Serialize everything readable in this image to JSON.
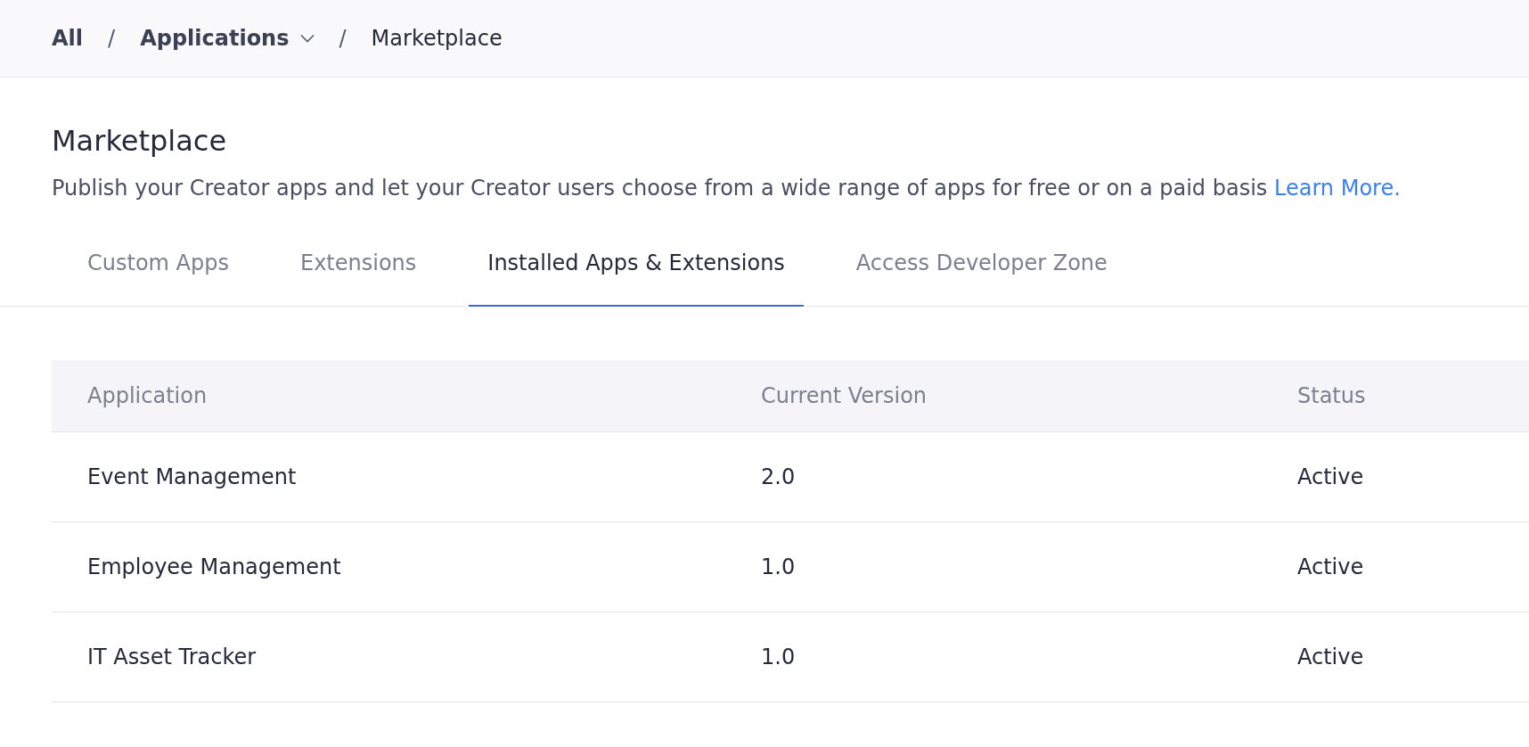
{
  "breadcrumb": [
    {
      "label": "All",
      "dropdown": false
    },
    {
      "label": "Applications",
      "dropdown": true
    },
    {
      "label": "Marketplace",
      "dropdown": false
    }
  ],
  "separator": "/",
  "page": {
    "title": "Marketplace",
    "description": "Publish your Creator apps and let your Creator users choose from a wide range of apps for free or on a paid basis",
    "link": "Learn More."
  },
  "tabs": [
    {
      "label": "Custom Apps",
      "selected": false
    },
    {
      "label": "Extensions",
      "selected": false
    },
    {
      "label": "Installed Apps & Extensions",
      "selected": true
    },
    {
      "label": "Access Developer Zone",
      "selected": false
    }
  ],
  "table": {
    "columns": [
      "Application",
      "Current Version",
      "Status"
    ],
    "rows": [
      [
        "Event Management",
        "2.0",
        "Active"
      ],
      [
        "Employee Management",
        "1.0",
        "Active"
      ],
      [
        "IT Asset Tracker",
        "1.0",
        "Active"
      ]
    ]
  }
}
